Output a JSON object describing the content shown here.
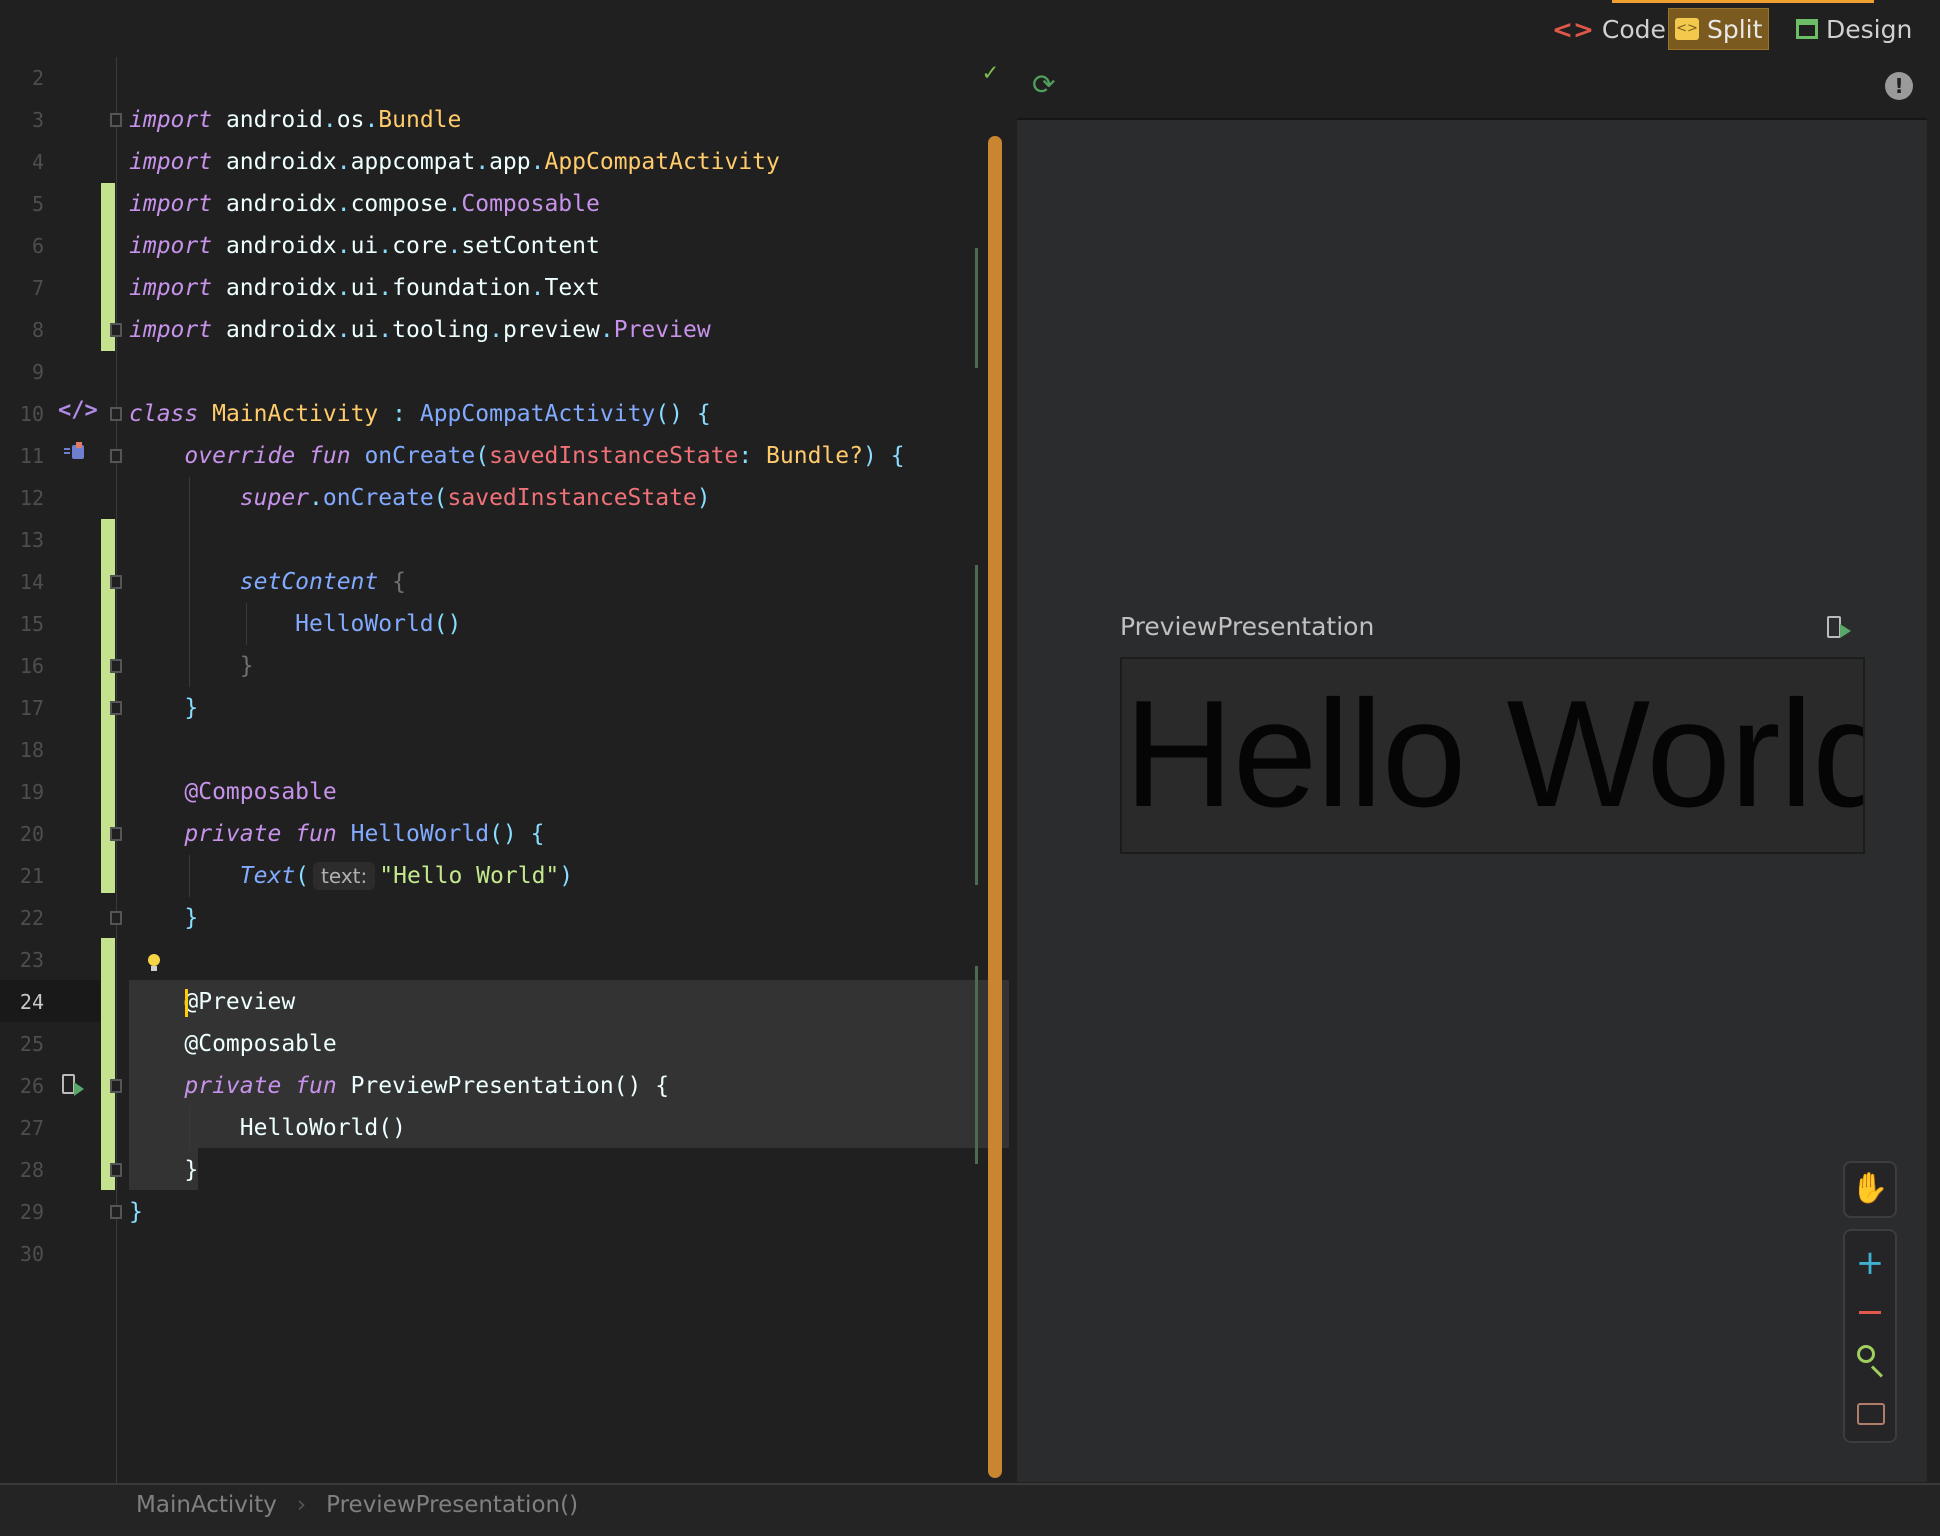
{
  "toolbar": {
    "modes": [
      {
        "label": "Code",
        "icon": "code-icon",
        "color": "#e0584a"
      },
      {
        "label": "Split",
        "icon": "split-icon",
        "color": "#f2c94c",
        "selected": true
      },
      {
        "label": "Design",
        "icon": "design-icon",
        "color": "#6dbf67"
      }
    ]
  },
  "editor": {
    "current_line": 24,
    "lines": [
      {
        "n": 2,
        "t": []
      },
      {
        "n": 3,
        "t": [
          [
            "kw",
            "import"
          ],
          [
            "plain",
            " android"
          ],
          [
            "punc",
            "."
          ],
          [
            "plain",
            "os"
          ],
          [
            "punc",
            "."
          ],
          [
            "type",
            "Bundle"
          ]
        ]
      },
      {
        "n": 4,
        "t": [
          [
            "kw",
            "import"
          ],
          [
            "plain",
            " androidx"
          ],
          [
            "punc",
            "."
          ],
          [
            "plain",
            "appcompat"
          ],
          [
            "punc",
            "."
          ],
          [
            "plain",
            "app"
          ],
          [
            "punc",
            "."
          ],
          [
            "type",
            "AppCompatActivity"
          ]
        ]
      },
      {
        "n": 5,
        "t": [
          [
            "kw",
            "import"
          ],
          [
            "plain",
            " androidx"
          ],
          [
            "punc",
            "."
          ],
          [
            "plain",
            "compose"
          ],
          [
            "punc",
            "."
          ],
          [
            "pur",
            "Composable"
          ]
        ]
      },
      {
        "n": 6,
        "t": [
          [
            "kw",
            "import"
          ],
          [
            "plain",
            " androidx"
          ],
          [
            "punc",
            "."
          ],
          [
            "plain",
            "ui"
          ],
          [
            "punc",
            "."
          ],
          [
            "plain",
            "core"
          ],
          [
            "punc",
            "."
          ],
          [
            "plain",
            "setContent"
          ]
        ]
      },
      {
        "n": 7,
        "t": [
          [
            "kw",
            "import"
          ],
          [
            "plain",
            " androidx"
          ],
          [
            "punc",
            "."
          ],
          [
            "plain",
            "ui"
          ],
          [
            "punc",
            "."
          ],
          [
            "plain",
            "foundation"
          ],
          [
            "punc",
            "."
          ],
          [
            "plain",
            "Text"
          ]
        ]
      },
      {
        "n": 8,
        "t": [
          [
            "kw",
            "import"
          ],
          [
            "plain",
            " androidx"
          ],
          [
            "punc",
            "."
          ],
          [
            "plain",
            "ui"
          ],
          [
            "punc",
            "."
          ],
          [
            "plain",
            "tooling"
          ],
          [
            "punc",
            "."
          ],
          [
            "plain",
            "preview"
          ],
          [
            "punc",
            "."
          ],
          [
            "pur",
            "Preview"
          ]
        ]
      },
      {
        "n": 9,
        "t": []
      },
      {
        "n": 10,
        "t": [
          [
            "kw",
            "class"
          ],
          [
            "plain",
            " "
          ],
          [
            "type",
            "MainActivity"
          ],
          [
            "plain",
            " "
          ],
          [
            "punc",
            ":"
          ],
          [
            "plain",
            " "
          ],
          [
            "fn",
            "AppCompatActivity"
          ],
          [
            "punc",
            "()"
          ],
          [
            "plain",
            " "
          ],
          [
            "punc",
            "{"
          ]
        ]
      },
      {
        "n": 11,
        "t": [
          [
            "plain",
            "    "
          ],
          [
            "kw",
            "override"
          ],
          [
            "plain",
            " "
          ],
          [
            "kw",
            "fun"
          ],
          [
            "plain",
            " "
          ],
          [
            "fn",
            "onCreate"
          ],
          [
            "punc",
            "("
          ],
          [
            "param",
            "savedInstanceState"
          ],
          [
            "punc",
            ":"
          ],
          [
            "plain",
            " "
          ],
          [
            "type",
            "Bundle?"
          ],
          [
            "punc",
            ")"
          ],
          [
            "plain",
            " "
          ],
          [
            "punc",
            "{"
          ]
        ]
      },
      {
        "n": 12,
        "t": [
          [
            "plain",
            "        "
          ],
          [
            "kw",
            "super"
          ],
          [
            "punc",
            "."
          ],
          [
            "fn",
            "onCreate"
          ],
          [
            "punc",
            "("
          ],
          [
            "param",
            "savedInstanceState"
          ],
          [
            "punc",
            ")"
          ]
        ]
      },
      {
        "n": 13,
        "t": []
      },
      {
        "n": 14,
        "t": [
          [
            "plain",
            "        "
          ],
          [
            "fni",
            "setContent"
          ],
          [
            "plain",
            " "
          ],
          [
            "dim",
            "{"
          ]
        ]
      },
      {
        "n": 15,
        "t": [
          [
            "plain",
            "            "
          ],
          [
            "fn",
            "HelloWorld"
          ],
          [
            "punc",
            "()"
          ]
        ]
      },
      {
        "n": 16,
        "t": [
          [
            "plain",
            "        "
          ],
          [
            "dim",
            "}"
          ]
        ]
      },
      {
        "n": 17,
        "t": [
          [
            "plain",
            "    "
          ],
          [
            "punc",
            "}"
          ]
        ]
      },
      {
        "n": 18,
        "t": []
      },
      {
        "n": 19,
        "t": [
          [
            "plain",
            "    "
          ],
          [
            "pur",
            "@Composable"
          ]
        ]
      },
      {
        "n": 20,
        "t": [
          [
            "plain",
            "    "
          ],
          [
            "kw",
            "private"
          ],
          [
            "plain",
            " "
          ],
          [
            "kw",
            "fun"
          ],
          [
            "plain",
            " "
          ],
          [
            "fn",
            "HelloWorld"
          ],
          [
            "punc",
            "()"
          ],
          [
            "plain",
            " "
          ],
          [
            "punc",
            "{"
          ]
        ]
      },
      {
        "n": 21,
        "t": [
          [
            "plain",
            "        "
          ],
          [
            "fni",
            "Text"
          ],
          [
            "punc",
            "("
          ],
          [
            "hint",
            "text:"
          ],
          [
            "str",
            "\"Hello World\""
          ],
          [
            "punc",
            ")"
          ]
        ]
      },
      {
        "n": 22,
        "t": [
          [
            "plain",
            "    "
          ],
          [
            "punc",
            "}"
          ]
        ]
      },
      {
        "n": 23,
        "t": []
      },
      {
        "n": 24,
        "t": [
          [
            "plain",
            "    @Preview"
          ]
        ]
      },
      {
        "n": 25,
        "t": [
          [
            "plain",
            "    @Composable"
          ]
        ]
      },
      {
        "n": 26,
        "t": [
          [
            "plain",
            "    "
          ],
          [
            "kw",
            "private"
          ],
          [
            "plain",
            " "
          ],
          [
            "kw",
            "fun"
          ],
          [
            "plain",
            " PreviewPresentation() {"
          ]
        ]
      },
      {
        "n": 27,
        "t": [
          [
            "plain",
            "        HelloWorld()"
          ]
        ]
      },
      {
        "n": 28,
        "t": [
          [
            "plain",
            "    }"
          ]
        ]
      },
      {
        "n": 29,
        "t": [
          [
            "punc",
            "}"
          ]
        ]
      },
      {
        "n": 30,
        "t": []
      }
    ]
  },
  "preview": {
    "title": "PreviewPresentation",
    "rendered_text": "Hello World"
  },
  "breadcrumb": [
    "MainActivity",
    "PreviewPresentation()"
  ],
  "breadcrumb_separator": "›"
}
